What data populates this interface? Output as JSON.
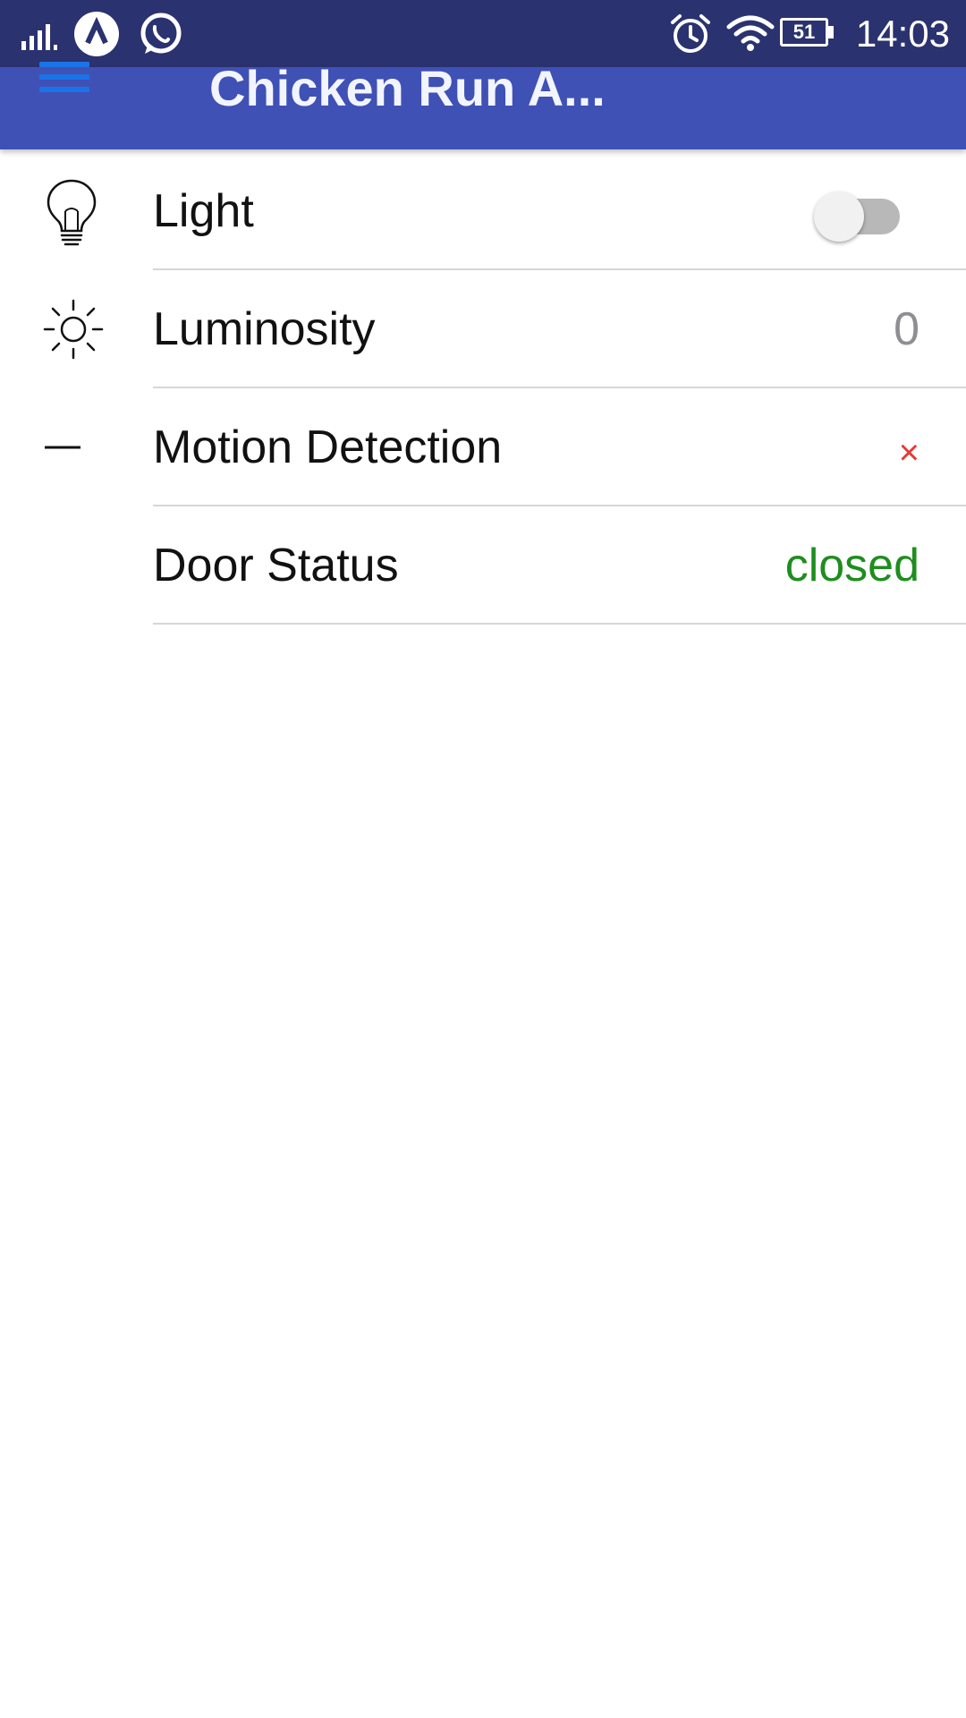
{
  "status_bar": {
    "time": "14:03",
    "battery_level": "51",
    "icons": [
      "signal-icon",
      "app-notification-icon",
      "whatsapp-icon",
      "alarm-icon",
      "wifi-icon",
      "battery-icon"
    ]
  },
  "app_bar": {
    "title": "Chicken Run A...",
    "menu_icon": "hamburger-menu-icon"
  },
  "items": [
    {
      "label": "Light",
      "icon": "lightbulb-icon",
      "control": "toggle",
      "toggle_on": false
    },
    {
      "label": "Luminosity",
      "icon": "sun-icon",
      "value": "0",
      "value_color": "#8e8e93"
    },
    {
      "label": "Motion Detection",
      "icon": "dash-icon",
      "value": "×",
      "value_color": "#e53935"
    },
    {
      "label": "Door Status",
      "icon": "",
      "value": "closed",
      "value_color": "#1e8e1e"
    }
  ],
  "colors": {
    "status_bar": "#2a3270",
    "app_bar": "#3f51b5",
    "divider": "#d6d6d6"
  }
}
